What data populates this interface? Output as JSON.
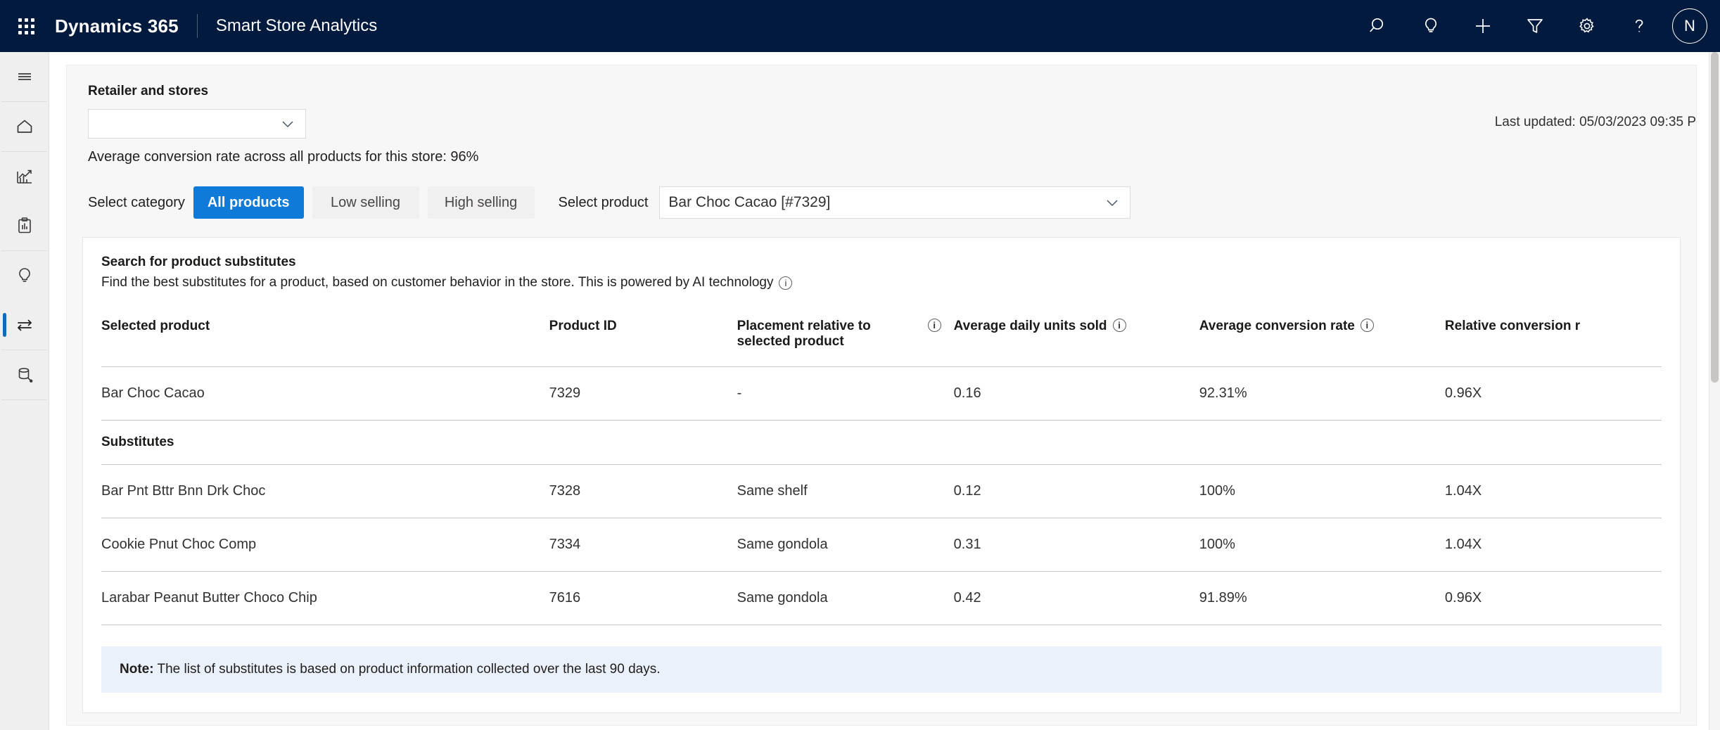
{
  "appbar": {
    "waffle_label": "app-launcher",
    "brand": "Dynamics 365",
    "app_name": "Smart Store Analytics",
    "icons": [
      {
        "name": "search-icon",
        "label": "Search"
      },
      {
        "name": "lightbulb-icon",
        "label": "Insights"
      },
      {
        "name": "plus-icon",
        "label": "New"
      },
      {
        "name": "filter-icon",
        "label": "Filter"
      },
      {
        "name": "gear-icon",
        "label": "Settings"
      },
      {
        "name": "help-icon",
        "label": "Help"
      }
    ],
    "avatar_initial": "N",
    "accent_color": "#021a3d"
  },
  "rail": {
    "items": [
      {
        "name": "hamburger-menu-icon",
        "label": "Menu",
        "active": false
      },
      {
        "name": "home-icon",
        "label": "Home",
        "active": false
      },
      {
        "name": "trending-chart-icon",
        "label": "Performance",
        "active": false
      },
      {
        "name": "clipboard-report-icon",
        "label": "Reports",
        "active": false
      },
      {
        "name": "lightbulb-icon",
        "label": "Insights",
        "active": false
      },
      {
        "name": "swap-arrows-icon",
        "label": "Substitutes",
        "active": true
      },
      {
        "name": "database-icon",
        "label": "Data",
        "active": false
      }
    ],
    "active_indicator_color": "#0f6cbd"
  },
  "filters": {
    "retailer_label": "Retailer and stores",
    "retailer_value": "",
    "retailer_placeholder": "",
    "last_updated": "Last updated: 05/03/2023 09:35 P",
    "average_conversion_line": "Average conversion rate across all products for this store: 96%",
    "select_category_label": "Select category",
    "categories": [
      {
        "label": "All products",
        "selected": true
      },
      {
        "label": "Low selling",
        "selected": false
      },
      {
        "label": "High selling",
        "selected": false
      }
    ],
    "selected_category_color": "#0f7ad8",
    "select_product_label": "Select product",
    "selected_product": "Bar Choc Cacao [#7329]"
  },
  "card": {
    "title": "Search for product substitutes",
    "subtitle": "Find the best substitutes for a product, based on customer behavior in the store. This is powered by AI technology",
    "subtitle_info_icon": "info-icon",
    "table": {
      "columns": [
        {
          "label": "Selected product",
          "info": false
        },
        {
          "label": "Product ID",
          "info": false
        },
        {
          "label": "Placement relative to selected product",
          "info": true
        },
        {
          "label": "Average daily units sold",
          "info": true
        },
        {
          "label": "Average conversion rate",
          "info": true
        },
        {
          "label": "Relative conversion r",
          "info": false
        }
      ],
      "selected_row": {
        "name": "Bar Choc Cacao",
        "product_id": "7329",
        "placement": "-",
        "avg_daily_units_sold": "0.16",
        "avg_conversion_rate": "92.31%",
        "relative_conversion_rate": "0.96X"
      },
      "group_label": "Substitutes",
      "substitutes": [
        {
          "name": "Bar Pnt Bttr Bnn Drk Choc",
          "product_id": "7328",
          "placement": "Same shelf",
          "avg_daily_units_sold": "0.12",
          "avg_conversion_rate": "100%",
          "relative_conversion_rate": "1.04X"
        },
        {
          "name": "Cookie Pnut Choc Comp",
          "product_id": "7334",
          "placement": "Same gondola",
          "avg_daily_units_sold": "0.31",
          "avg_conversion_rate": "100%",
          "relative_conversion_rate": "1.04X"
        },
        {
          "name": "Larabar Peanut Butter Choco Chip",
          "product_id": "7616",
          "placement": "Same gondola",
          "avg_daily_units_sold": "0.42",
          "avg_conversion_rate": "91.89%",
          "relative_conversion_rate": "0.96X"
        }
      ]
    },
    "note_prefix": "Note:",
    "note_text": "The list of substitutes is based on product information collected over the last 90 days.",
    "note_background": "#eaf1fb"
  }
}
